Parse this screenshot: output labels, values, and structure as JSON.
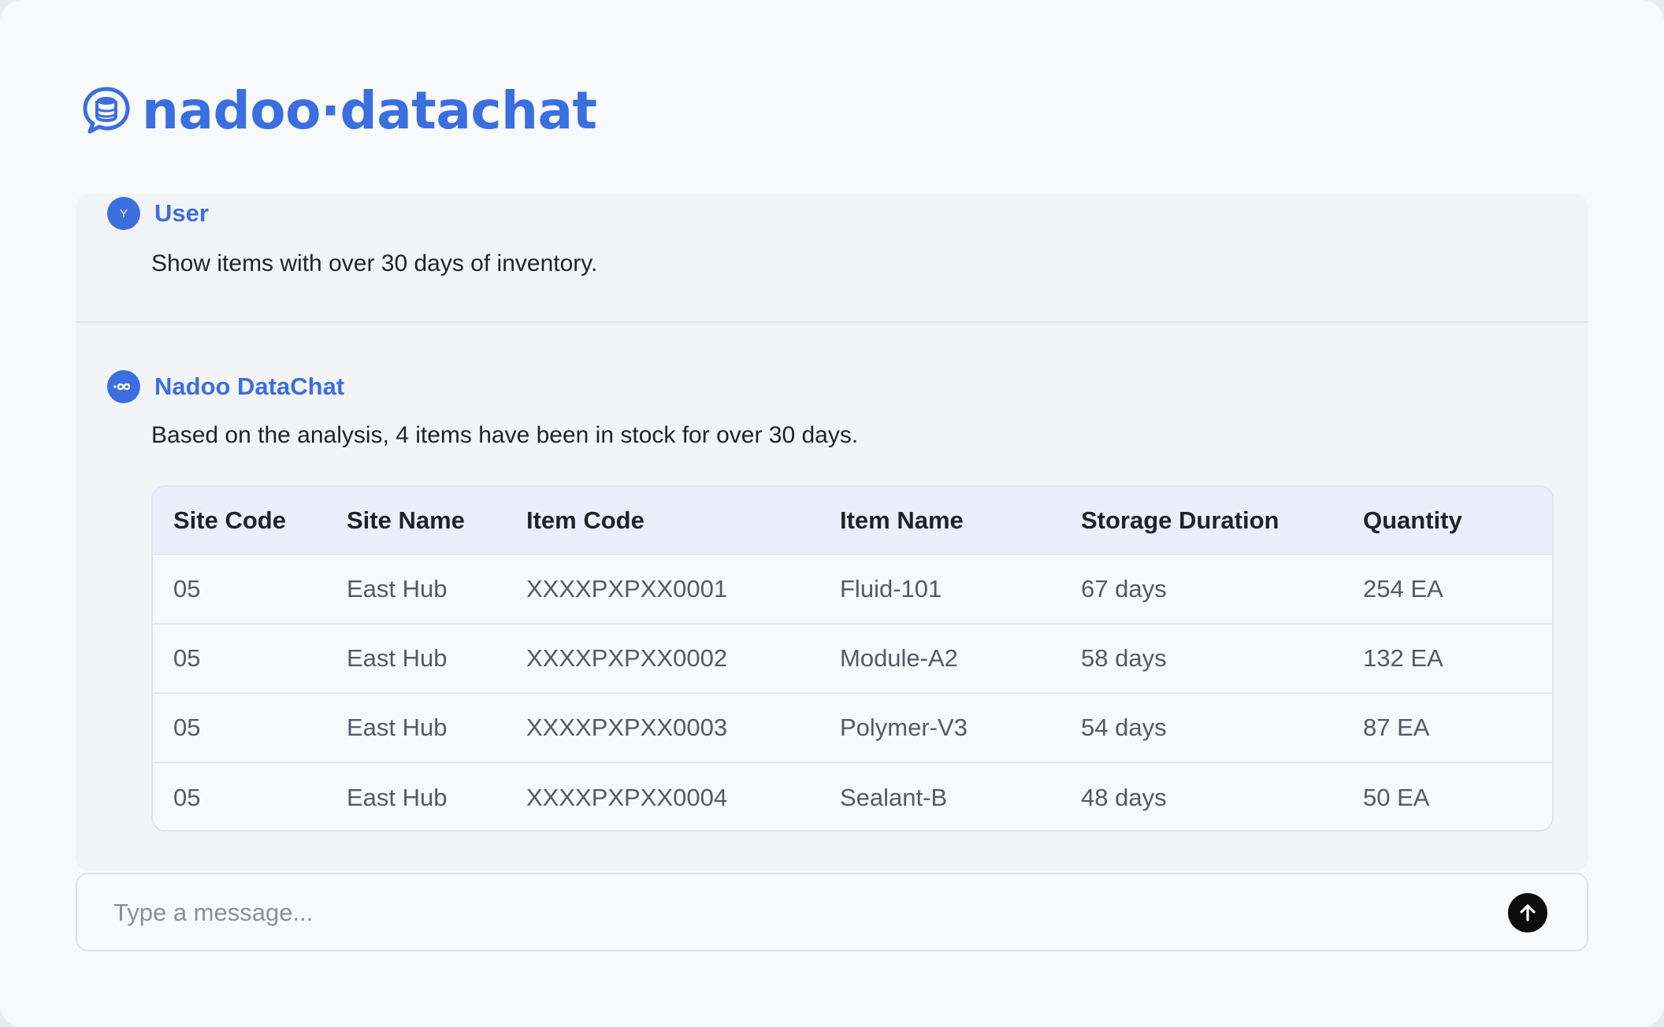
{
  "brand": {
    "name": "nadoo·datachat"
  },
  "messages": {
    "user": {
      "avatar_initial": "Y",
      "sender": "User",
      "text": "Show items with over 30 days of inventory."
    },
    "bot": {
      "avatar_icon": "infinity-icon",
      "sender": "Nadoo DataChat",
      "text": "Based on the analysis, 4 items have been in stock for over 30 days."
    }
  },
  "table": {
    "headers": [
      "Site Code",
      "Site Name",
      "Item Code",
      "Item Name",
      "Storage Duration",
      "Quantity"
    ],
    "rows": [
      [
        "05",
        "East Hub",
        "XXXXPXPXX0001",
        "Fluid-101",
        "67 days",
        "254 EA"
      ],
      [
        "05",
        "East Hub",
        "XXXXPXPXX0002",
        "Module-A2",
        "58 days",
        "132 EA"
      ],
      [
        "05",
        "East Hub",
        "XXXXPXPXX0003",
        "Polymer-V3",
        "54 days",
        "87 EA"
      ],
      [
        "05",
        "East Hub",
        "XXXXPXPXX0004",
        "Sealant-B",
        "48 days",
        "50 EA"
      ]
    ]
  },
  "composer": {
    "placeholder": "Type a message...",
    "value": "",
    "send_icon": "arrow-up-icon"
  },
  "colors": {
    "accent": "#3b6fe0",
    "background": "#f8f9fb",
    "table_header": "#eceffb"
  }
}
